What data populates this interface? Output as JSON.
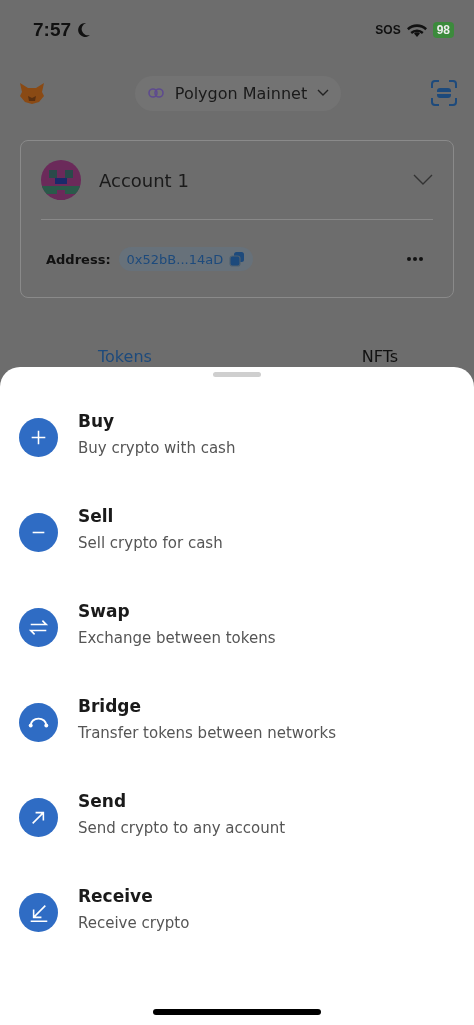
{
  "status_bar": {
    "time": "7:57",
    "carrier": "SOS",
    "battery": "98"
  },
  "header": {
    "network": "Polygon Mainnet"
  },
  "account": {
    "name": "Account 1",
    "address_label": "Address:",
    "address": "0x52bB...14aD"
  },
  "tabs": [
    {
      "label": "Tokens",
      "selected": true
    },
    {
      "label": "NFTs",
      "selected": false
    }
  ],
  "actions": [
    {
      "kind": "buy",
      "title": "Buy",
      "subtitle": "Buy crypto with cash"
    },
    {
      "kind": "sell",
      "title": "Sell",
      "subtitle": "Sell crypto for cash"
    },
    {
      "kind": "swap",
      "title": "Swap",
      "subtitle": "Exchange between tokens"
    },
    {
      "kind": "bridge",
      "title": "Bridge",
      "subtitle": "Transfer tokens between networks"
    },
    {
      "kind": "send",
      "title": "Send",
      "subtitle": "Send crypto to any account"
    },
    {
      "kind": "receive",
      "title": "Receive",
      "subtitle": "Receive crypto"
    }
  ]
}
